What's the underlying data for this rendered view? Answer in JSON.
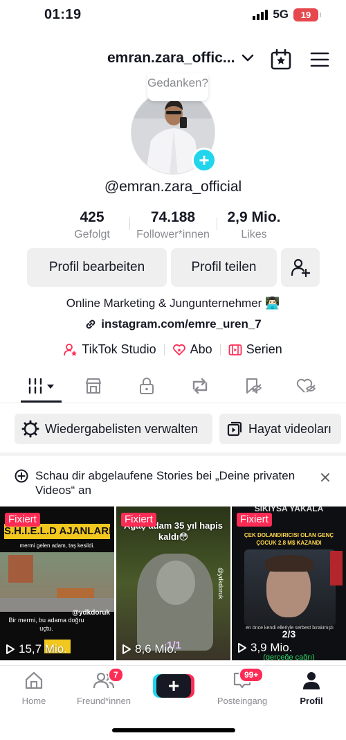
{
  "status_bar": {
    "time": "01:19",
    "network": "5G",
    "battery": "19"
  },
  "header": {
    "username": "emran.zara_offic..."
  },
  "profile": {
    "bubble_text": "Gedanken?",
    "handle": "@emran.zara_official",
    "stats": [
      {
        "value": "425",
        "label": "Gefolgt"
      },
      {
        "value": "74.188",
        "label": "Follower*innen"
      },
      {
        "value": "2,9 Mio.",
        "label": "Likes"
      }
    ],
    "edit_label": "Profil bearbeiten",
    "share_label": "Profil teilen",
    "bio": "Online Marketing & Jungunternehmer 👨🏻‍💻",
    "link": "instagram.com/emre_uren_7",
    "quick_links": [
      "TikTok Studio",
      "Abo",
      "Serien"
    ]
  },
  "playlists": {
    "manage_label": "Wiedergabelisten verwalten",
    "playlist_label": "Hayat videoları"
  },
  "notice": {
    "text": "Schau dir abgelaufene Stories bei „Deine privaten Videos“ an"
  },
  "videos": [
    {
      "pinned": "Fixiert",
      "views": "15,7 Mio.",
      "title": "S.H.I.E.L.D AJANLARI",
      "caption": "mermi gelen adam, taş kesildi.",
      "sub": "Bir mermi, bu adama doğru uçtu.",
      "credit": "@ydkdoruk"
    },
    {
      "pinned": "Fixiert",
      "views": "8,6 Mio.",
      "title": "Ağaç adam 35 yıl hapis kaldı😳",
      "credit": "@ydkdoruk",
      "badge": "1/1"
    },
    {
      "pinned": "Fixiert",
      "views": "3,9 Mio.",
      "title": "SIKIYSA YAKALA",
      "caption": "ÇEK DOLANDIRICISI OLAN GENÇ ÇOCUK 2.8 M$ KAZANDI",
      "sub": "en önce kendi elleriyle serbest bırakmıştı",
      "badge": "2/3",
      "footer": "(gerçeğe çağrı)"
    }
  ],
  "bottom_nav": {
    "home": "Home",
    "friends": "Freund*innen",
    "friends_badge": "7",
    "inbox": "Posteingang",
    "inbox_badge": "99+",
    "profile": "Profil"
  },
  "colors": {
    "accent": "#fe2c55",
    "cyan": "#20d5ec"
  }
}
